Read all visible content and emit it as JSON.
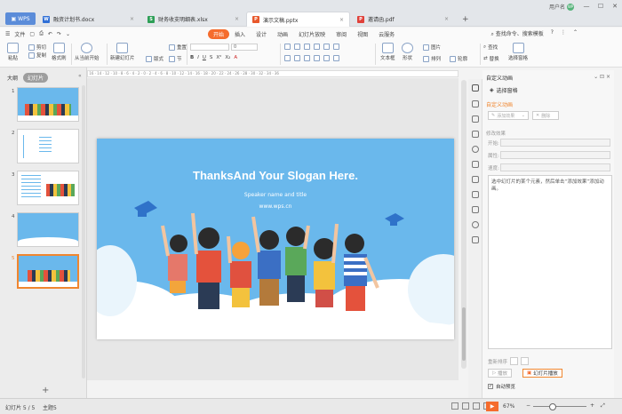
{
  "app": {
    "name": "WPS"
  },
  "tabs": [
    {
      "label": "融资计划书.docx",
      "icon": "word-doc-icon",
      "color": "#2f6fd6"
    },
    {
      "label": "财务收支明细表.xlsx",
      "icon": "excel-sheet-icon",
      "color": "#2e9f57"
    },
    {
      "label": "演示文稿.pptx",
      "icon": "ppt-slides-icon",
      "color": "#e8582c",
      "active": true
    },
    {
      "label": "邀请函.pdf",
      "icon": "pdf-doc-icon",
      "color": "#e0413a"
    }
  ],
  "user": {
    "name": "用户名",
    "avatar_text": "WP"
  },
  "menubar": {
    "file_label": "文件",
    "items": [
      "开始",
      "插入",
      "设计",
      "动画",
      "幻灯片放映",
      "审阅",
      "视图",
      "云服务"
    ],
    "active": "开始",
    "search": "查找命令、搜索模板"
  },
  "ribbon": {
    "paste": "粘贴",
    "cut": "剪切",
    "copy": "复制",
    "format_painter": "格式刷",
    "play_from_start": "从当前开始",
    "new_slide": "新建幻灯片",
    "layout": "版式",
    "section": "节",
    "reset": "重置",
    "font_size": "0",
    "textbox": "文本框",
    "shape": "形状",
    "picture": "图片",
    "arrange": "排列",
    "outline": "轮廓",
    "find": "查找",
    "replace": "替换",
    "select_pane": "选择窗格"
  },
  "left_panel": {
    "outline_tab": "大纲",
    "slides_tab": "幻灯片",
    "slide_numbers": [
      "1",
      "2",
      "3",
      "4",
      "5"
    ],
    "selected": 5
  },
  "slide": {
    "title": "ThanksAnd Your Slogan Here.",
    "subtitle": "Speaker name and title",
    "url": "www.wps.cn",
    "bg_color": "#6ab8ec"
  },
  "right_panel": {
    "title": "自定义动画",
    "select_pane": "选择窗格",
    "section_title": "自定义动画",
    "add_effect": "添加效果",
    "delete": "删除",
    "modify_label": "修改效果",
    "field_start": "开始:",
    "field_property": "属性:",
    "field_speed": "速度:",
    "hint": "选中幻灯片的某个元素，然后单击“添加效果”添加动画。",
    "reorder": "重新排序",
    "play": "播放",
    "slideshow": "幻灯片播放",
    "autopreview": "自动预览"
  },
  "status": {
    "slide_info": "幻灯片 5 / 5",
    "theme": "主题5",
    "zoom": "67%"
  },
  "colors": {
    "accent": "#f56c2d",
    "tab_bar": "#e3e6ea"
  }
}
